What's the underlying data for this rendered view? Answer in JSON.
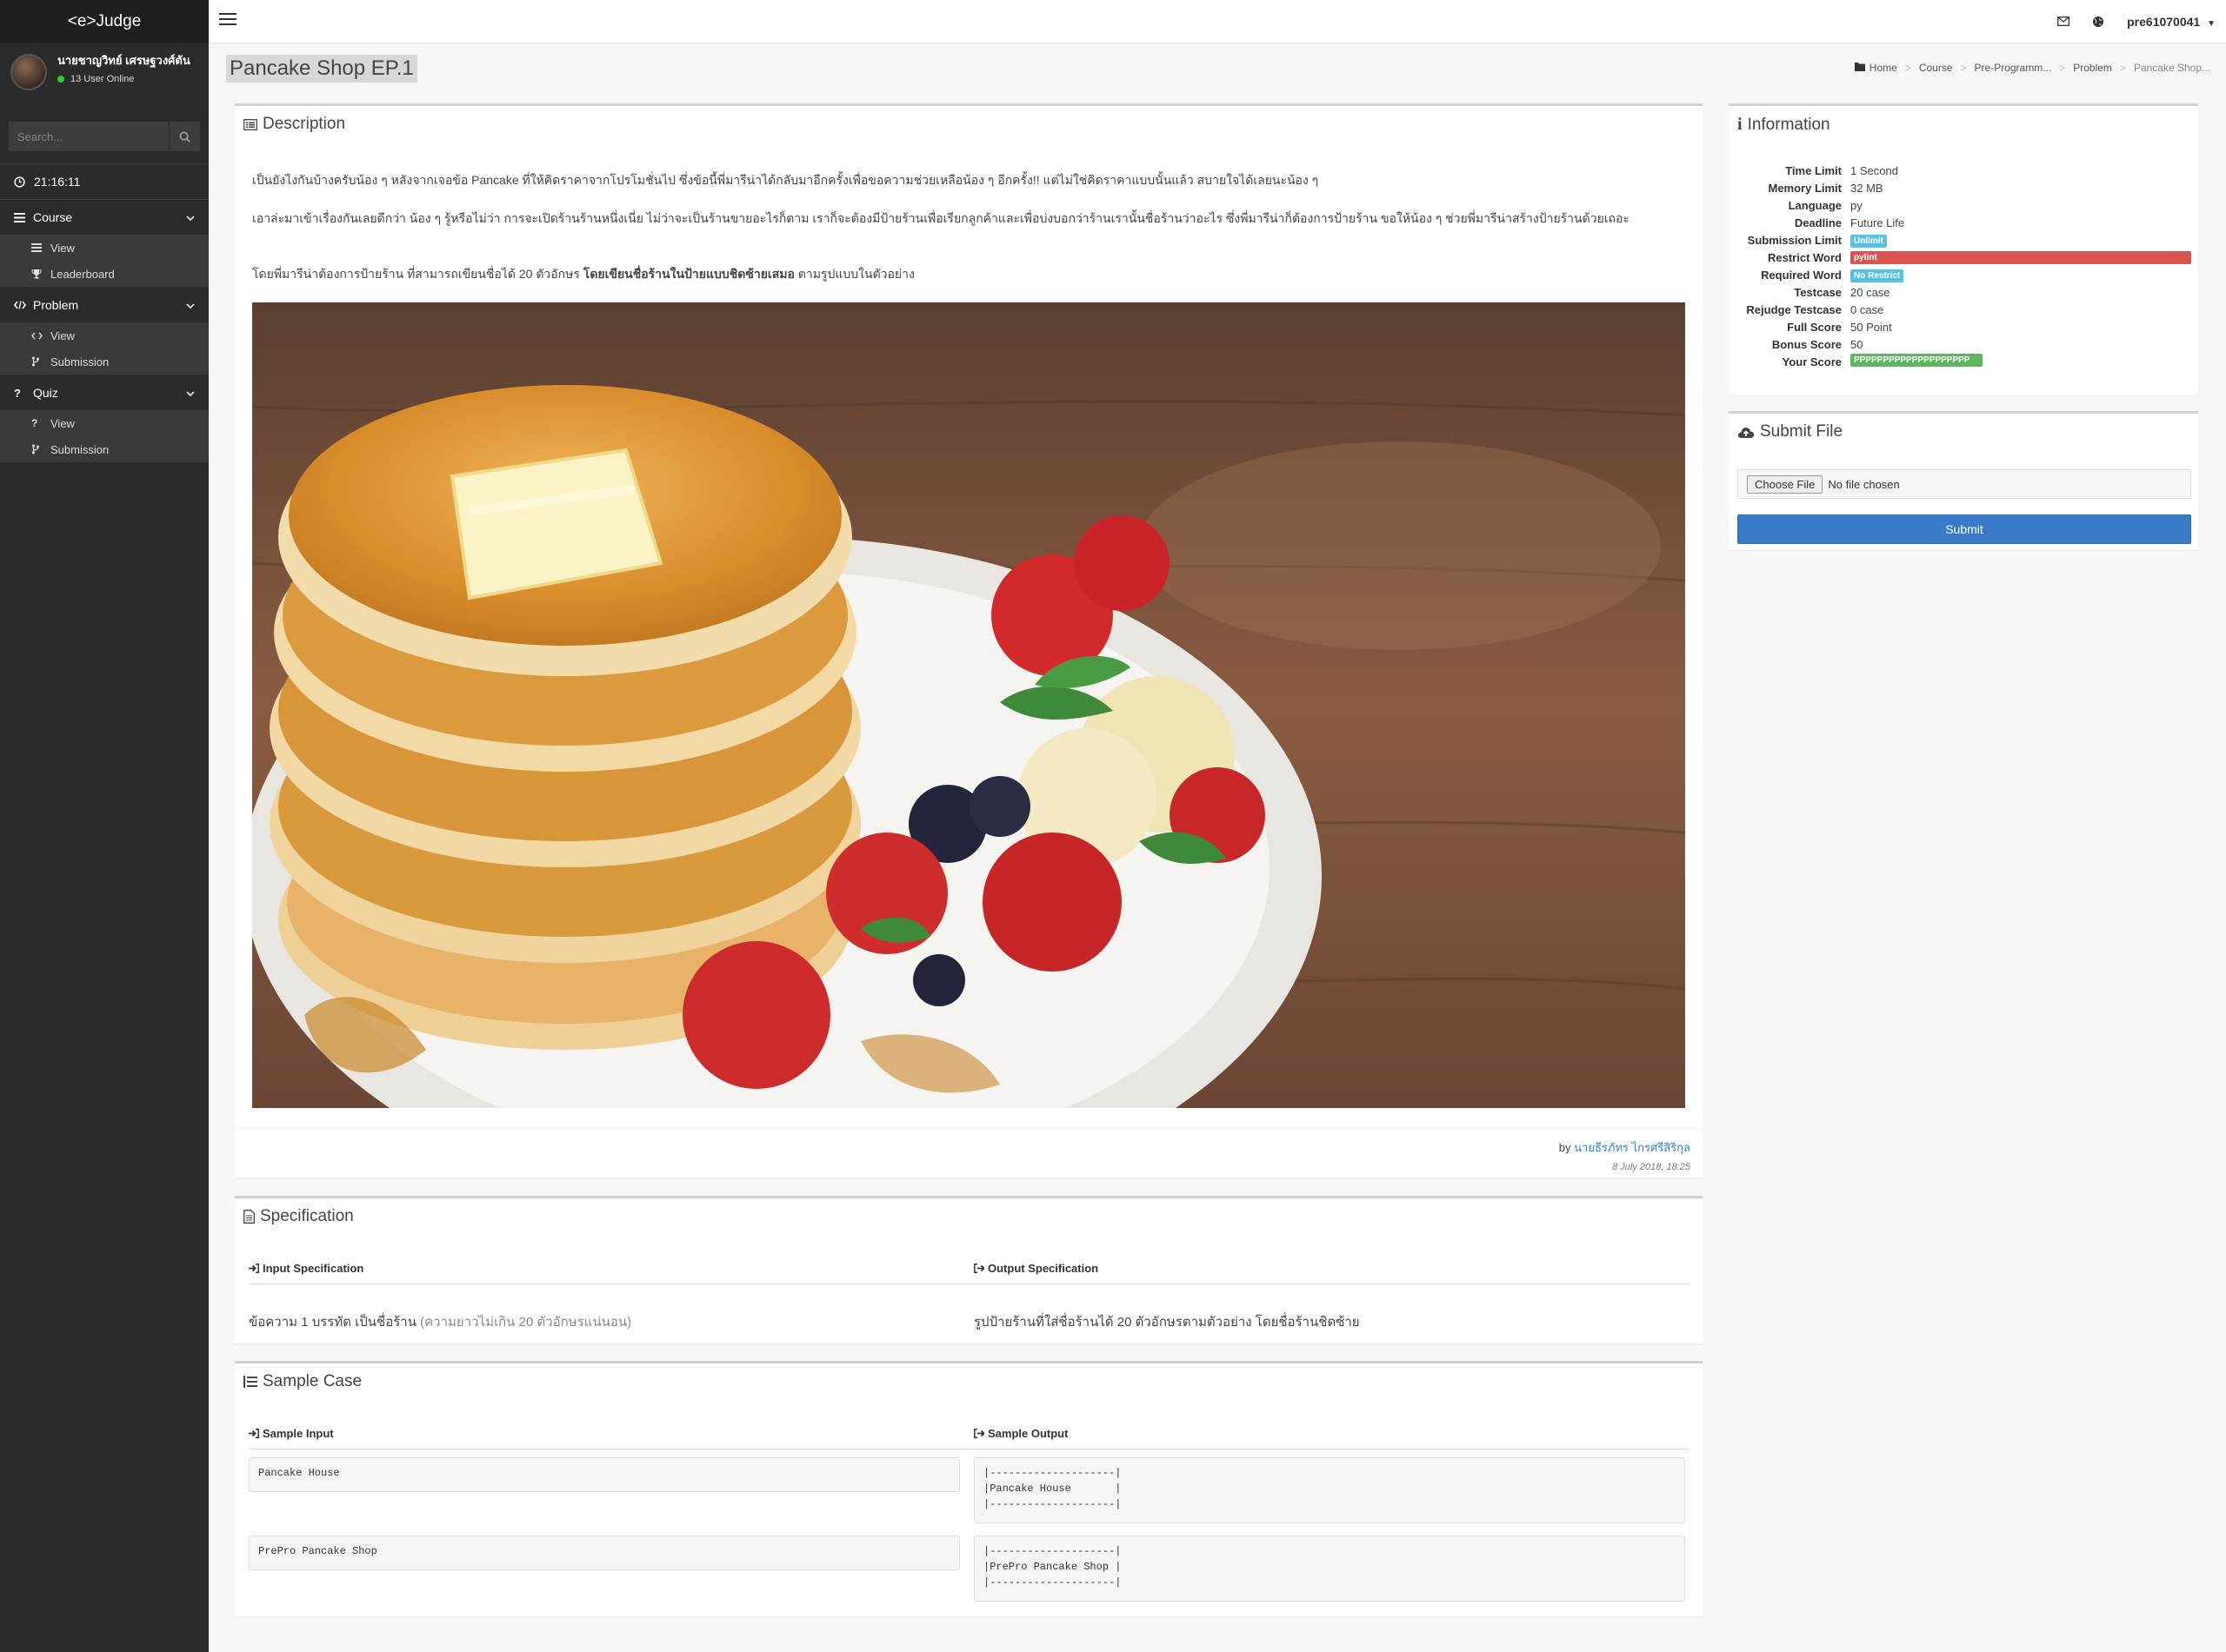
{
  "app": {
    "brand": "<e>Judge"
  },
  "user": {
    "name": "นายชาญวิทย์ เศรษฐวงศ์ตัน",
    "online": "13 User Online"
  },
  "search": {
    "placeholder": "Search..."
  },
  "clock": "21:16:11",
  "menu": {
    "course": {
      "label": "Course",
      "items": [
        "View",
        "Leaderboard"
      ]
    },
    "problem": {
      "label": "Problem",
      "items": [
        "View",
        "Submission"
      ]
    },
    "quiz": {
      "label": "Quiz",
      "items": [
        "View",
        "Submission"
      ]
    }
  },
  "topbar": {
    "username": "pre61070041"
  },
  "page": {
    "title": "Pancake Shop EP.1",
    "breadcrumb": [
      "Home",
      "Course",
      "Pre-Programm...",
      "Problem",
      "Pancake Shop..."
    ]
  },
  "description": {
    "heading": "Description",
    "p1": "เป็นยังไงกันบ้างครับน้อง ๆ หลังจากเจอข้อ Pancake ที่ให้คิดราคาจากโปรโมชั่นไป ซึ่งข้อนี้พี่มารีน่าได้กลับมาอีกครั้งเพื่อขอความช่วยเหลือน้อง ๆ อีกครั้ง!! แต่ไม่ใช่คิดราคาแบบนั้นแล้ว สบายใจได้เลยนะน้อง ๆ",
    "p2": "เอาล่ะมาเข้าเรื่องกันเลยดีกว่า น้อง ๆ รู้หรือไม่ว่า การจะเปิดร้านร้านหนึ่งเนี่ย ไม่ว่าจะเป็นร้านขายอะไรก็ตาม เราก็จะต้องมีป้ายร้านเพื่อเรียกลูกค้าและเพื่อบ่งบอกว่าร้านเรานั้นชื่อร้านว่าอะไร ซึ่งพี่มารีน่าก็ต้องการป้ายร้าน ขอให้น้อง ๆ ช่วยพี่มารีน่าสร้างป้ายร้านด้วยเถอะ",
    "p3_pre": "โดยพี่มารีน่าต้องการป้ายร้าน ที่สามารถเขียนชื่อได้ 20 ตัวอักษร ",
    "p3_bold": "โดยเขียนชื่อร้านในป้ายแบบชิดซ้ายเสมอ",
    "p3_post": " ตามรูปแบบในตัวอย่าง",
    "by": "by",
    "author": "นายธีรภัทร ไกรศรีสิริกุล",
    "date": "8 July 2018, 18:25"
  },
  "info": {
    "heading": "Information",
    "rows": [
      {
        "key": "Time Limit",
        "val": "1 Second"
      },
      {
        "key": "Memory Limit",
        "val": "32 MB"
      },
      {
        "key": "Language",
        "val": "py"
      },
      {
        "key": "Deadline",
        "val": "Future Life"
      },
      {
        "key": "Submission Limit",
        "val": "Unlimit"
      },
      {
        "key": "Restrict Word",
        "val": "pylint"
      },
      {
        "key": "Required Word",
        "val": "No Restrict"
      },
      {
        "key": "Testcase",
        "val": "20 case"
      },
      {
        "key": "Rejudge Testcase",
        "val": "0 case"
      },
      {
        "key": "Full Score",
        "val": "50 Point"
      },
      {
        "key": "Bonus Score",
        "val": "50"
      },
      {
        "key": "Your Score",
        "val": "PPPPPPPPPPPPPPPPPPPP"
      }
    ],
    "colors": {
      "info": "#5bc0de",
      "danger": "#d9534f",
      "success": "#5cb85c"
    }
  },
  "submit": {
    "heading": "Submit File",
    "choose": "Choose File",
    "nofile": "No file chosen",
    "button": "Submit"
  },
  "spec": {
    "heading": "Specification",
    "input_head": "Input Specification",
    "output_head": "Output Specification",
    "input_text": "ข้อความ 1 บรรทัด เป็นชื่อร้าน",
    "input_muted": "(ความยาวไม่เกิน 20 ตัวอักษรแน่นอน)",
    "output_text": "รูปป้ายร้านที่ใส่ชื่อร้านได้ 20 ตัวอักษรตามตัวอย่าง โดยชื่อร้านชิดซ้าย"
  },
  "sample": {
    "heading": "Sample Case",
    "input_head": "Sample Input",
    "output_head": "Sample Output",
    "input1": "Pancake House",
    "output1": "|--------------------|\n|Pancake House       |\n|--------------------|",
    "input2": "PrePro Pancake Shop",
    "output2": "|--------------------|\n|PrePro Pancake Shop |\n|--------------------|"
  }
}
